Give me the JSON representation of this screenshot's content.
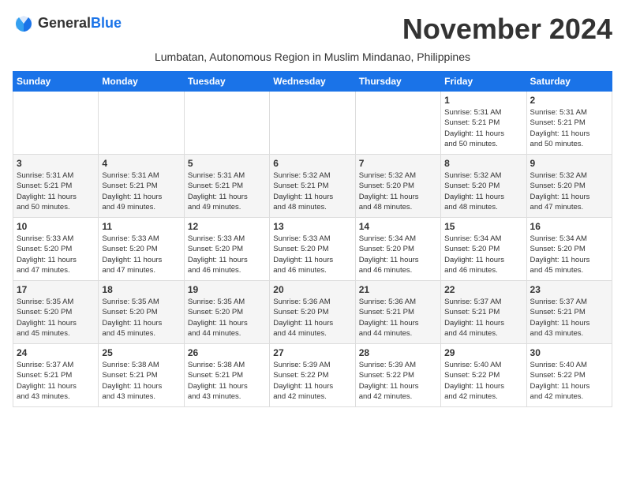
{
  "logo": {
    "general": "General",
    "blue": "Blue"
  },
  "title": "November 2024",
  "subtitle": "Lumbatan, Autonomous Region in Muslim Mindanao, Philippines",
  "days_of_week": [
    "Sunday",
    "Monday",
    "Tuesday",
    "Wednesday",
    "Thursday",
    "Friday",
    "Saturday"
  ],
  "weeks": [
    [
      {
        "day": "",
        "info": ""
      },
      {
        "day": "",
        "info": ""
      },
      {
        "day": "",
        "info": ""
      },
      {
        "day": "",
        "info": ""
      },
      {
        "day": "",
        "info": ""
      },
      {
        "day": "1",
        "info": "Sunrise: 5:31 AM\nSunset: 5:21 PM\nDaylight: 11 hours\nand 50 minutes."
      },
      {
        "day": "2",
        "info": "Sunrise: 5:31 AM\nSunset: 5:21 PM\nDaylight: 11 hours\nand 50 minutes."
      }
    ],
    [
      {
        "day": "3",
        "info": "Sunrise: 5:31 AM\nSunset: 5:21 PM\nDaylight: 11 hours\nand 50 minutes."
      },
      {
        "day": "4",
        "info": "Sunrise: 5:31 AM\nSunset: 5:21 PM\nDaylight: 11 hours\nand 49 minutes."
      },
      {
        "day": "5",
        "info": "Sunrise: 5:31 AM\nSunset: 5:21 PM\nDaylight: 11 hours\nand 49 minutes."
      },
      {
        "day": "6",
        "info": "Sunrise: 5:32 AM\nSunset: 5:21 PM\nDaylight: 11 hours\nand 48 minutes."
      },
      {
        "day": "7",
        "info": "Sunrise: 5:32 AM\nSunset: 5:20 PM\nDaylight: 11 hours\nand 48 minutes."
      },
      {
        "day": "8",
        "info": "Sunrise: 5:32 AM\nSunset: 5:20 PM\nDaylight: 11 hours\nand 48 minutes."
      },
      {
        "day": "9",
        "info": "Sunrise: 5:32 AM\nSunset: 5:20 PM\nDaylight: 11 hours\nand 47 minutes."
      }
    ],
    [
      {
        "day": "10",
        "info": "Sunrise: 5:33 AM\nSunset: 5:20 PM\nDaylight: 11 hours\nand 47 minutes."
      },
      {
        "day": "11",
        "info": "Sunrise: 5:33 AM\nSunset: 5:20 PM\nDaylight: 11 hours\nand 47 minutes."
      },
      {
        "day": "12",
        "info": "Sunrise: 5:33 AM\nSunset: 5:20 PM\nDaylight: 11 hours\nand 46 minutes."
      },
      {
        "day": "13",
        "info": "Sunrise: 5:33 AM\nSunset: 5:20 PM\nDaylight: 11 hours\nand 46 minutes."
      },
      {
        "day": "14",
        "info": "Sunrise: 5:34 AM\nSunset: 5:20 PM\nDaylight: 11 hours\nand 46 minutes."
      },
      {
        "day": "15",
        "info": "Sunrise: 5:34 AM\nSunset: 5:20 PM\nDaylight: 11 hours\nand 46 minutes."
      },
      {
        "day": "16",
        "info": "Sunrise: 5:34 AM\nSunset: 5:20 PM\nDaylight: 11 hours\nand 45 minutes."
      }
    ],
    [
      {
        "day": "17",
        "info": "Sunrise: 5:35 AM\nSunset: 5:20 PM\nDaylight: 11 hours\nand 45 minutes."
      },
      {
        "day": "18",
        "info": "Sunrise: 5:35 AM\nSunset: 5:20 PM\nDaylight: 11 hours\nand 45 minutes."
      },
      {
        "day": "19",
        "info": "Sunrise: 5:35 AM\nSunset: 5:20 PM\nDaylight: 11 hours\nand 44 minutes."
      },
      {
        "day": "20",
        "info": "Sunrise: 5:36 AM\nSunset: 5:20 PM\nDaylight: 11 hours\nand 44 minutes."
      },
      {
        "day": "21",
        "info": "Sunrise: 5:36 AM\nSunset: 5:21 PM\nDaylight: 11 hours\nand 44 minutes."
      },
      {
        "day": "22",
        "info": "Sunrise: 5:37 AM\nSunset: 5:21 PM\nDaylight: 11 hours\nand 44 minutes."
      },
      {
        "day": "23",
        "info": "Sunrise: 5:37 AM\nSunset: 5:21 PM\nDaylight: 11 hours\nand 43 minutes."
      }
    ],
    [
      {
        "day": "24",
        "info": "Sunrise: 5:37 AM\nSunset: 5:21 PM\nDaylight: 11 hours\nand 43 minutes."
      },
      {
        "day": "25",
        "info": "Sunrise: 5:38 AM\nSunset: 5:21 PM\nDaylight: 11 hours\nand 43 minutes."
      },
      {
        "day": "26",
        "info": "Sunrise: 5:38 AM\nSunset: 5:21 PM\nDaylight: 11 hours\nand 43 minutes."
      },
      {
        "day": "27",
        "info": "Sunrise: 5:39 AM\nSunset: 5:22 PM\nDaylight: 11 hours\nand 42 minutes."
      },
      {
        "day": "28",
        "info": "Sunrise: 5:39 AM\nSunset: 5:22 PM\nDaylight: 11 hours\nand 42 minutes."
      },
      {
        "day": "29",
        "info": "Sunrise: 5:40 AM\nSunset: 5:22 PM\nDaylight: 11 hours\nand 42 minutes."
      },
      {
        "day": "30",
        "info": "Sunrise: 5:40 AM\nSunset: 5:22 PM\nDaylight: 11 hours\nand 42 minutes."
      }
    ]
  ]
}
